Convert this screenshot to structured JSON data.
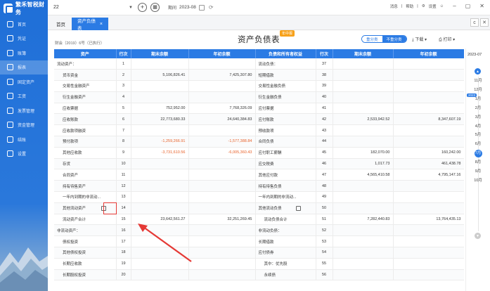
{
  "app": {
    "name": "繁禾智税财务",
    "company": "22",
    "period_label": "期间",
    "period": "2023-08"
  },
  "top_right": {
    "help": "帮助",
    "message": "消息",
    "settings": "设置"
  },
  "sidebar": {
    "items": [
      {
        "label": "首页"
      },
      {
        "label": "凭证"
      },
      {
        "label": "账簿"
      },
      {
        "label": "报表"
      },
      {
        "label": "固定资产"
      },
      {
        "label": "工资"
      },
      {
        "label": "发票管理"
      },
      {
        "label": "资金管理"
      },
      {
        "label": "结账"
      },
      {
        "label": "设置"
      }
    ]
  },
  "tabs": {
    "home": "首页",
    "active": "资产负债表",
    "close": "×"
  },
  "report": {
    "title": "资产负债表",
    "badge": "年中报",
    "subtitle": "财会（2019）6号（已执行）",
    "seg_left": "重分类",
    "seg_right": "不重分类",
    "download": "下载",
    "print": "打印"
  },
  "table": {
    "headers": [
      "资产",
      "行次",
      "期末余额",
      "年初余额",
      "负债和所有者权益",
      "行次",
      "期末余额",
      "年初余额"
    ],
    "rows": [
      [
        "流动资产：",
        "1",
        "",
        "",
        "流动负债：",
        "37",
        "",
        ""
      ],
      [
        "货币资金",
        "2",
        "5,106,826.41",
        "7,425,307.80",
        "短期借款",
        "38",
        "",
        ""
      ],
      [
        "交易性金融资产",
        "3",
        "",
        "",
        "交易性金融负债",
        "39",
        "",
        ""
      ],
      [
        "衍生金融资产",
        "4",
        "",
        "",
        "衍生金融负债",
        "40",
        "",
        ""
      ],
      [
        "应收票据",
        "5",
        "752,952.00",
        "7,768,326.09",
        "应付票据",
        "41",
        "",
        ""
      ],
      [
        "应收账款",
        "6",
        "22,773,680.33",
        "24,640,384.83",
        "应付账款",
        "42",
        "2,533,942.52",
        "8,347,607.19"
      ],
      [
        "应收款项融资",
        "7",
        "",
        "",
        "预收款项",
        "43",
        "",
        ""
      ],
      [
        "预付款项",
        "8",
        "-1,259,266.91",
        "-1,577,388.84",
        "合同负债",
        "44",
        "",
        ""
      ],
      [
        "其他应收款",
        "9",
        "-3,731,610.56",
        "-6,005,360.43",
        "应付职工薪酬",
        "45",
        "182,070.00",
        "160,242.00"
      ],
      [
        "存货",
        "10",
        "",
        "",
        "应交税费",
        "46",
        "1,017.73",
        "461,438.78"
      ],
      [
        "合同资产",
        "11",
        "",
        "",
        "其他应付款",
        "47",
        "4,565,410.58",
        "4,795,147.16"
      ],
      [
        "持有待售资产",
        "12",
        "",
        "",
        "持有待售负债",
        "48",
        "",
        ""
      ],
      [
        "一年内到期的非流动...",
        "13",
        "",
        "",
        "一年内到期的非流动...",
        "49",
        "",
        ""
      ],
      [
        "其他流动资产",
        "14",
        "",
        "",
        "其他流动负债",
        "50",
        "",
        ""
      ],
      [
        "流动资产合计",
        "15",
        "23,642,561.27",
        "32,251,269.45",
        "流动负债合计",
        "51",
        "7,282,440.83",
        "13,764,435.13"
      ],
      [
        "非流动资产：",
        "16",
        "",
        "",
        "非流动负债：",
        "52",
        "",
        ""
      ],
      [
        "债权投资",
        "17",
        "",
        "",
        "长期借款",
        "53",
        "",
        ""
      ],
      [
        "其他债权投资",
        "18",
        "",
        "",
        "应付债券",
        "54",
        "",
        ""
      ],
      [
        "长期应收款",
        "19",
        "",
        "",
        "其中：优先股",
        "55",
        "",
        ""
      ],
      [
        "长期股权投资",
        "20",
        "",
        "",
        "永续债",
        "56",
        "",
        ""
      ]
    ]
  },
  "timeline": {
    "year": "2023-07",
    "tag": "2023",
    "months": [
      "11月",
      "12月",
      "1月",
      "2月",
      "3月",
      "4月",
      "5月",
      "6月",
      "7月",
      "8月",
      "9月",
      "10月"
    ],
    "selected": "7月"
  },
  "colors": {
    "accent": "#2b7be4",
    "negative": "#e8622a",
    "highlight_box": "#e53935"
  }
}
